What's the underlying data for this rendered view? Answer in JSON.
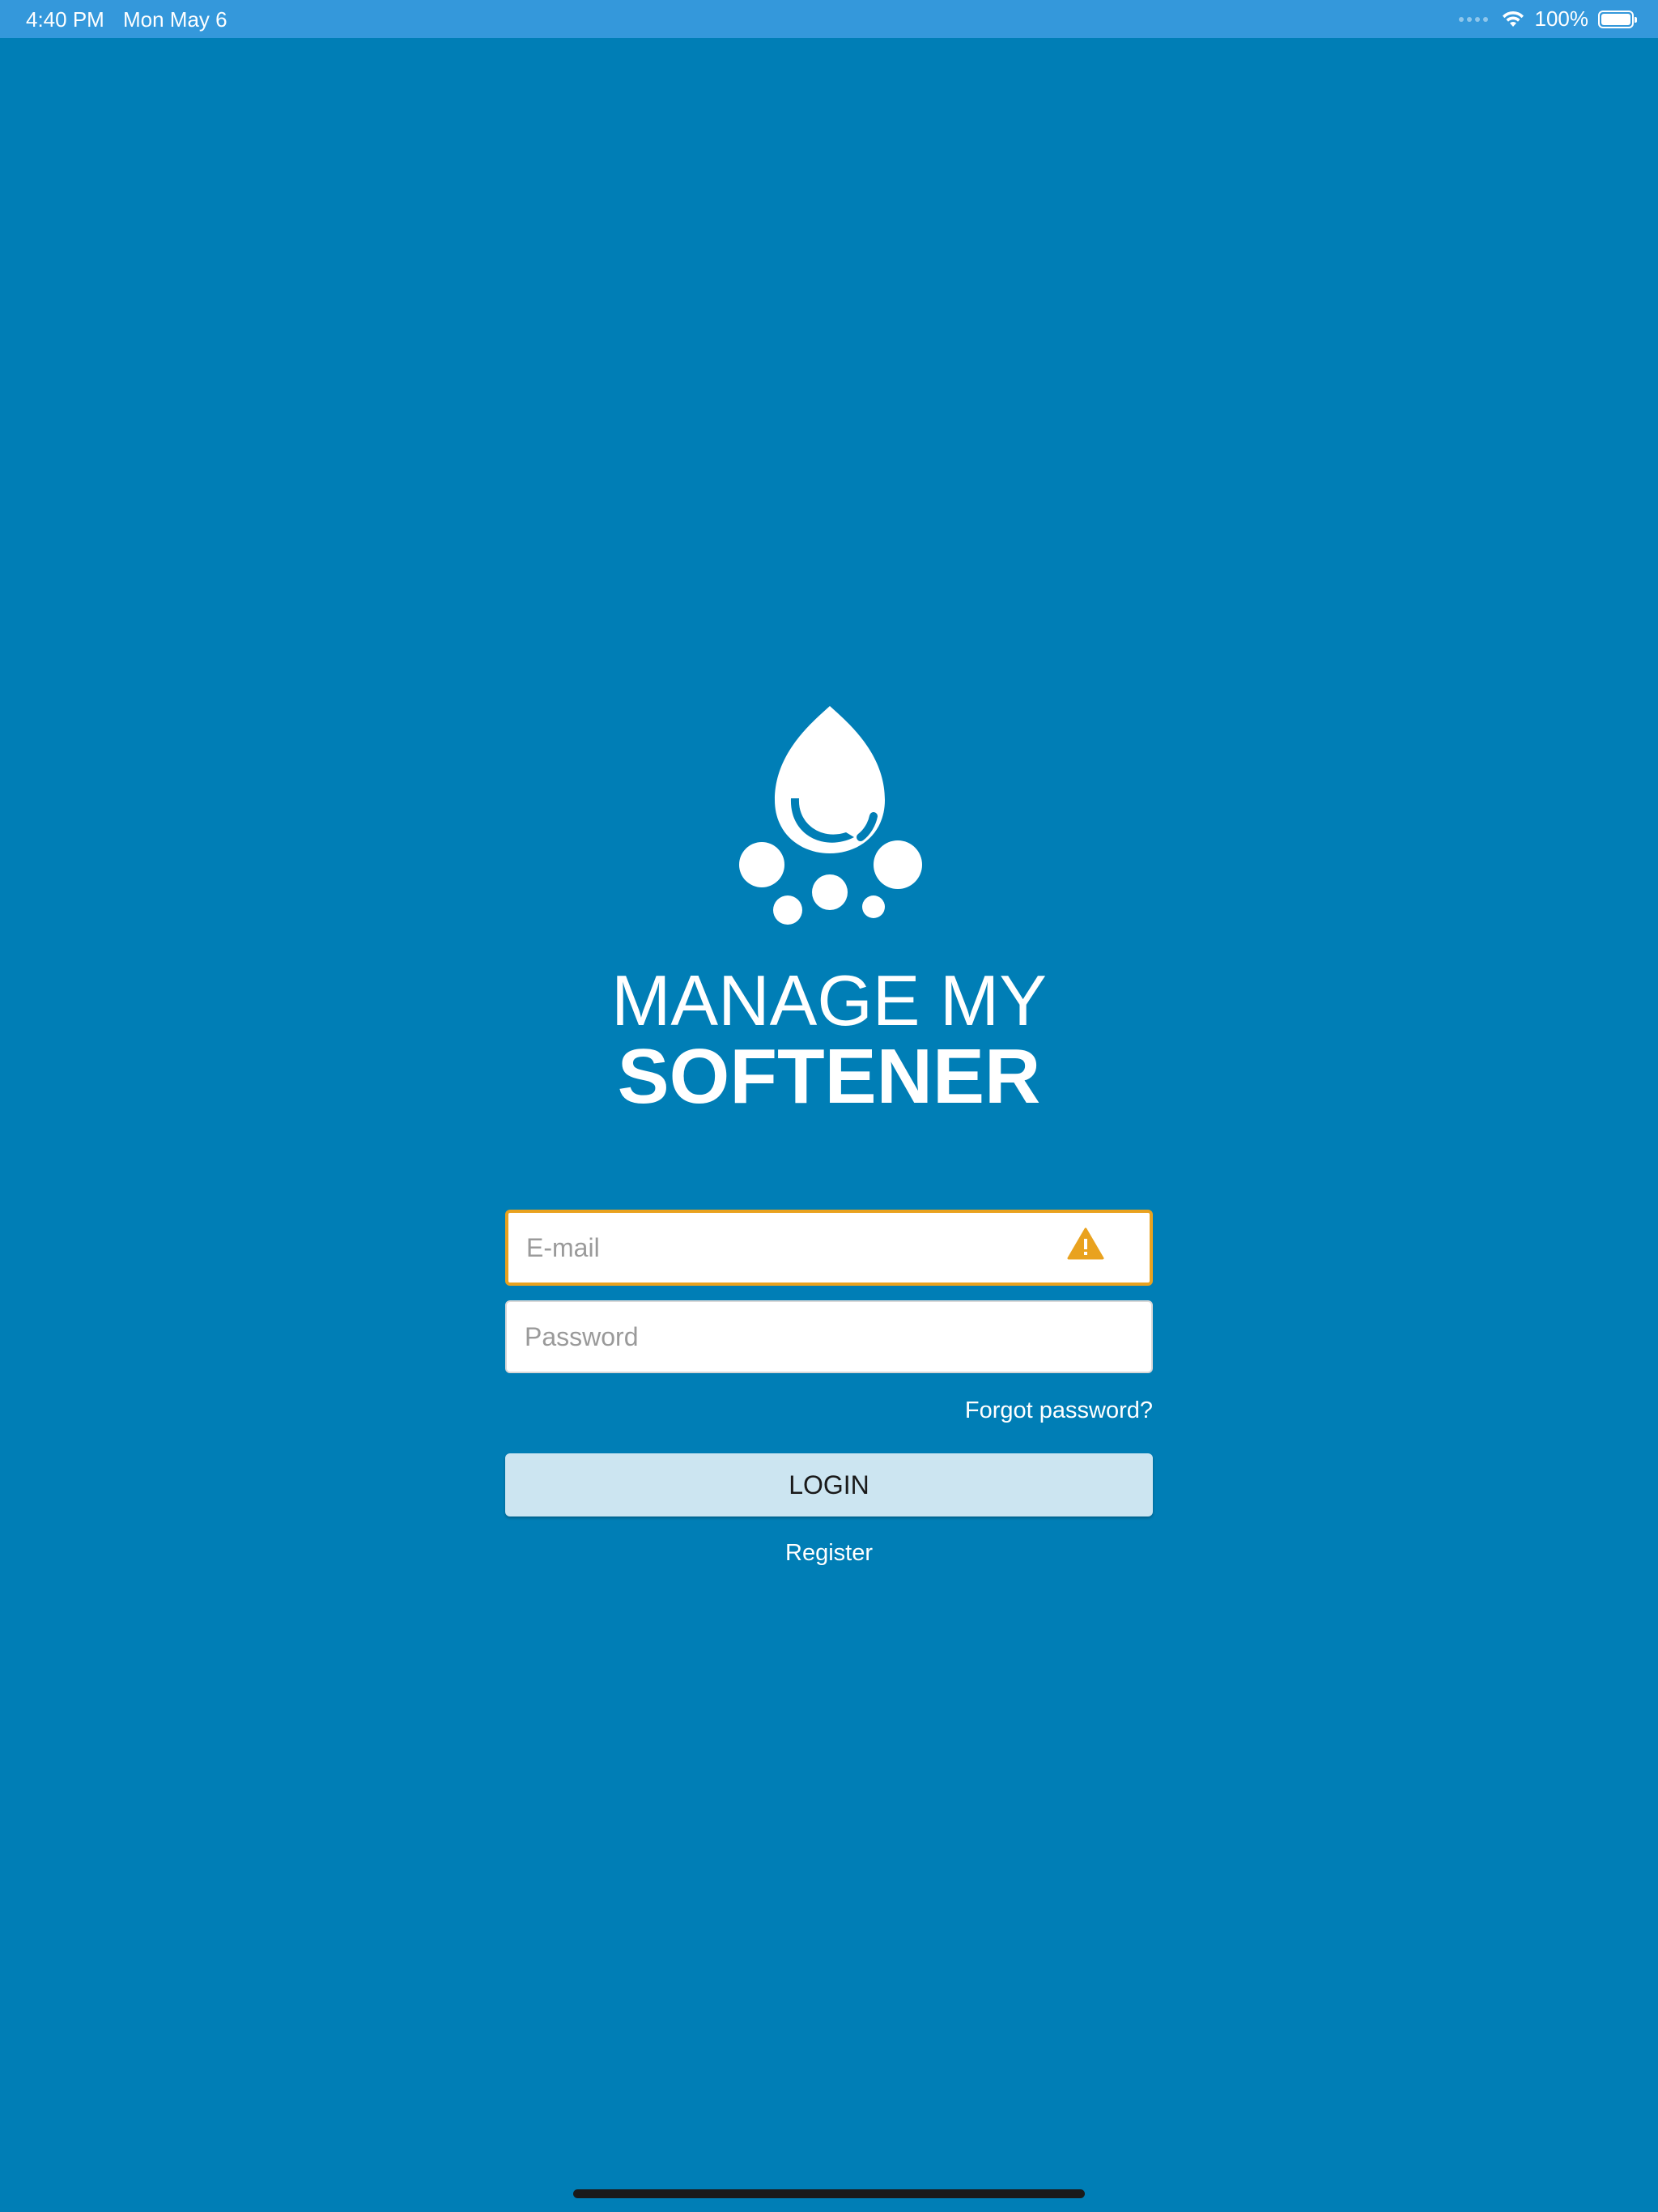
{
  "status_bar": {
    "time": "4:40 PM",
    "date": "Mon May 6",
    "battery_text": "100%"
  },
  "brand": {
    "line1": "MANAGE MY",
    "line2": "SOFTENER"
  },
  "form": {
    "email_placeholder": "E-mail",
    "email_value": "",
    "password_placeholder": "Password",
    "password_value": "",
    "forgot_label": "Forgot password?",
    "login_label": "LOGIN",
    "register_label": "Register"
  },
  "colors": {
    "background": "#007eb6",
    "status_bar": "#3498db",
    "warning": "#e9a21f",
    "login_button": "#cce5f1"
  },
  "icons": {
    "logo": "water-drop-bubbles-icon",
    "email_warning": "warning-triangle-icon",
    "wifi": "wifi-icon",
    "battery": "battery-icon",
    "signal": "cellular-signal-icon"
  }
}
